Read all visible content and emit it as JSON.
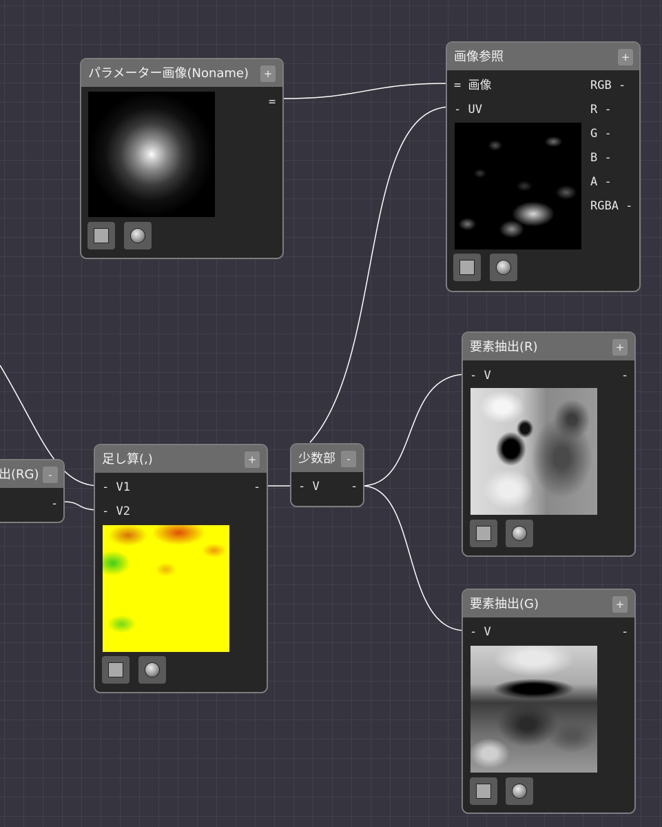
{
  "canvas": {
    "background": "#36343f",
    "wire_color": "#ffffff"
  },
  "nodes": {
    "param_image": {
      "title": "パラメーター画像(Noname)",
      "header_button": "+",
      "output_port": "="
    },
    "image_ref": {
      "title": "画像参照",
      "header_button": "+",
      "inputs": [
        "= 画像",
        "- UV"
      ],
      "outputs": [
        "RGB -",
        "R -",
        "G -",
        "B -",
        "A -",
        "RGBA -"
      ]
    },
    "extract_r": {
      "title": "要素抽出(R)",
      "header_button": "+",
      "input": "- V",
      "output": "-"
    },
    "extract_g": {
      "title": "要素抽出(G)",
      "header_button": "+",
      "input": "- V",
      "output": "-"
    },
    "add": {
      "title": "足し算(,)",
      "header_button": "+",
      "inputs": [
        "- V1",
        "- V2"
      ],
      "output": "-"
    },
    "fraction": {
      "title": "少数部",
      "header_button": "-",
      "input": "- V",
      "output": "-"
    },
    "extract_rg": {
      "title": "出(RG)",
      "header_button": "-",
      "output": "-"
    }
  },
  "icons": {
    "preview_flat": "square-preview-icon",
    "preview_sphere": "sphere-preview-icon"
  }
}
